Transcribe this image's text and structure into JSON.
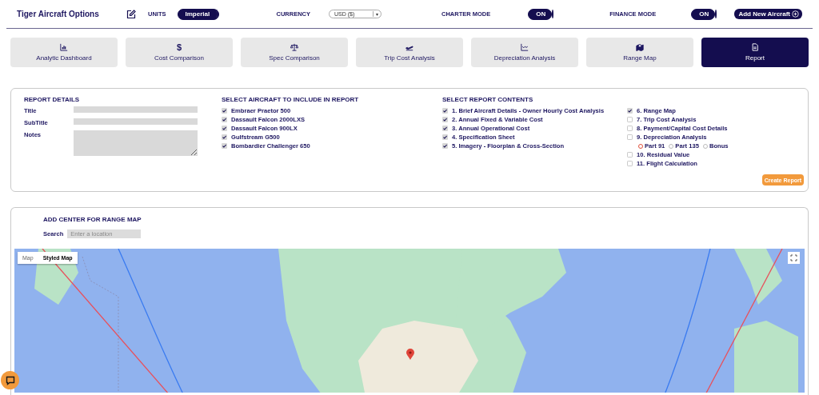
{
  "header": {
    "title": "Tiger Aircraft Options",
    "units": {
      "label": "UNITS",
      "value": "Imperial",
      "on": true
    },
    "currency": {
      "label": "CURRENCY",
      "value": "USD ($)",
      "caret": "▾"
    },
    "modes": [
      {
        "label": "CHARTER MODE",
        "value": "ON",
        "on": true
      },
      {
        "label": "FINANCE MODE",
        "value": "ON",
        "on": true
      }
    ],
    "add_button": "Add New Aircraft"
  },
  "tabs": [
    {
      "label": "Analytic Dashboard",
      "selected": false
    },
    {
      "label": "Cost Comparison",
      "glyph": "$",
      "selected": false
    },
    {
      "label": "Spec Comparison",
      "selected": false
    },
    {
      "label": "Trip Cost Analysis",
      "selected": false
    },
    {
      "label": "Depreciation Analysis",
      "selected": false
    },
    {
      "label": "Range Map",
      "selected": false
    },
    {
      "label": "Report",
      "selected": true
    }
  ],
  "report": {
    "details": {
      "heading": "REPORT DETAILS",
      "fields": [
        {
          "label": "Title",
          "kind": "input"
        },
        {
          "label": "SubTitle",
          "kind": "input"
        },
        {
          "label": "Notes",
          "kind": "textarea"
        }
      ]
    },
    "aircraft": {
      "heading": "SELECT AIRCRAFT TO INCLUDE IN REPORT",
      "items": [
        {
          "label": "Embraer Praetor 500",
          "checked": true
        },
        {
          "label": "Dassault Falcon 2000LXS",
          "checked": true
        },
        {
          "label": "Dassault Falcon 900LX",
          "checked": true
        },
        {
          "label": "Gulfstream G500",
          "checked": true
        },
        {
          "label": "Bombardier Challenger 650",
          "checked": true
        }
      ]
    },
    "contents": {
      "heading": "SELECT REPORT CONTENTS",
      "columns": [
        [
          {
            "label": "1. Brief Aircraft Details - Owner Hourly Cost Analysis",
            "checked": true
          },
          {
            "label": "2. Annual Fixed & Variable Cost",
            "checked": true
          },
          {
            "label": "3. Annual Operational Cost",
            "checked": true
          },
          {
            "label": "4. Specification Sheet",
            "checked": true
          },
          {
            "label": "5. Imagery - Floorplan & Cross-Section",
            "checked": true
          }
        ],
        [
          {
            "label": "6. Range Map",
            "checked": true
          },
          {
            "label": "7. Trip Cost Analysis",
            "checked": false
          },
          {
            "label": "8. Payment/Capital Cost Details",
            "checked": false
          },
          {
            "label": "9. Depreciation Analysis",
            "checked": false,
            "options": [
              {
                "label": "Part 91",
                "selected": true
              },
              {
                "label": "Part 135",
                "selected": false
              },
              {
                "label": "Bonus",
                "selected": false
              }
            ]
          },
          {
            "label": "10. Residual Value",
            "checked": false
          },
          {
            "label": "11. Flight Calculation",
            "checked": false
          }
        ]
      ]
    },
    "create_button": "Create Report"
  },
  "range_map": {
    "heading": "ADD CENTER FOR RANGE MAP",
    "search_label": "Search",
    "placeholder": "Enter a location",
    "map_types": [
      {
        "label": "Map",
        "selected": false
      },
      {
        "label": "Styled Map",
        "selected": true
      }
    ]
  }
}
